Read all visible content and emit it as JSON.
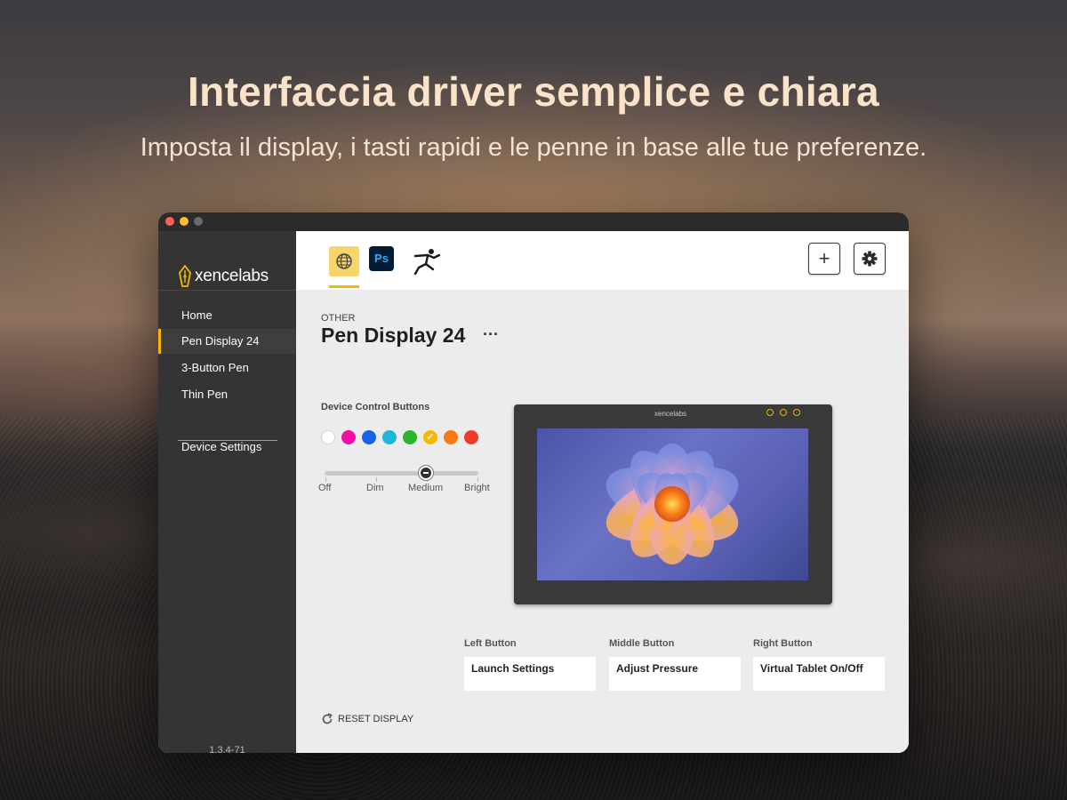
{
  "hero": {
    "title": "Interfaccia driver semplice e chiara",
    "subtitle": "Imposta il display, i tasti rapidi e le penne in base alle tue preferenze."
  },
  "app": {
    "logo_text": "xencelabs",
    "version": "1.3.4-71"
  },
  "sidebar": {
    "items": [
      {
        "label": "Home",
        "active": false
      },
      {
        "label": "Pen Display 24",
        "active": true
      },
      {
        "label": "3-Button Pen",
        "active": false
      },
      {
        "label": "Thin Pen",
        "active": false
      }
    ],
    "settings_label": "Device Settings"
  },
  "toolbar": {
    "app_tabs": [
      {
        "name": "global",
        "icon": "globe-icon",
        "active": true
      },
      {
        "name": "Ps",
        "icon": "photoshop-icon",
        "active": false
      },
      {
        "name": "ZBrush",
        "icon": "zbrush-icon",
        "active": false
      }
    ],
    "photoshop_label": "Ps",
    "add_icon": "plus-icon",
    "settings_icon": "gear-icon"
  },
  "page": {
    "breadcrumb": "OTHER",
    "title": "Pen Display 24",
    "more": "···"
  },
  "device_control": {
    "label": "Device Control Buttons",
    "colors": [
      "#ffffff",
      "#f20ea5",
      "#1662e8",
      "#1cb9d6",
      "#2ab52a",
      "#f7b800",
      "#f97a12",
      "#ee3b2c"
    ],
    "selected_color_index": 5,
    "brightness_levels": [
      "Off",
      "Dim",
      "Medium",
      "Bright"
    ],
    "brightness_selected": "Medium"
  },
  "device_preview": {
    "brand": "xencelabs",
    "led_count": 3
  },
  "buttons": [
    {
      "label": "Left Button",
      "value": "Launch Settings"
    },
    {
      "label": "Middle Button",
      "value": "Adjust Pressure"
    },
    {
      "label": "Right Button",
      "value": "Virtual Tablet On/Off"
    }
  ],
  "reset_label": "RESET DISPLAY",
  "colors": {
    "accent": "#f5b800",
    "sidebar_bg": "#343434",
    "main_bg": "#ececec"
  }
}
